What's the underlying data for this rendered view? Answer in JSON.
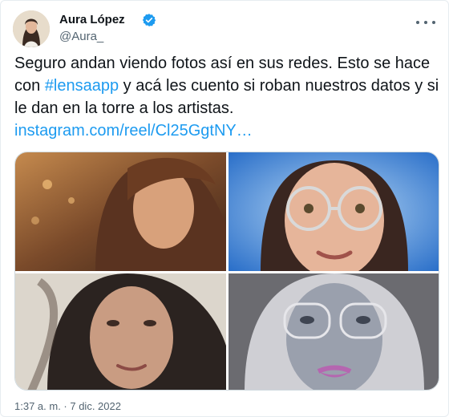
{
  "tweet": {
    "author_name": "Aura López",
    "author_handle": "@Aura_",
    "text_before": "Seguro andan viendo fotos así en sus redes. Esto se hace con ",
    "hashtag": "#lensaapp",
    "text_after": " y acá les cuento si roban nuestros datos y si le dan en la torre a los artistas.",
    "link": "instagram.com/reel/Cl25GgtNY…",
    "timestamp": "1:37 a. m. · 7 dic. 2022"
  },
  "icons": {
    "verified": "verified-badge-icon",
    "more": "more-options-icon"
  },
  "colors": {
    "link": "#1d9bf0",
    "verified": "#1d9bf0",
    "secondary_text": "#536471"
  },
  "media": {
    "count": 4
  }
}
